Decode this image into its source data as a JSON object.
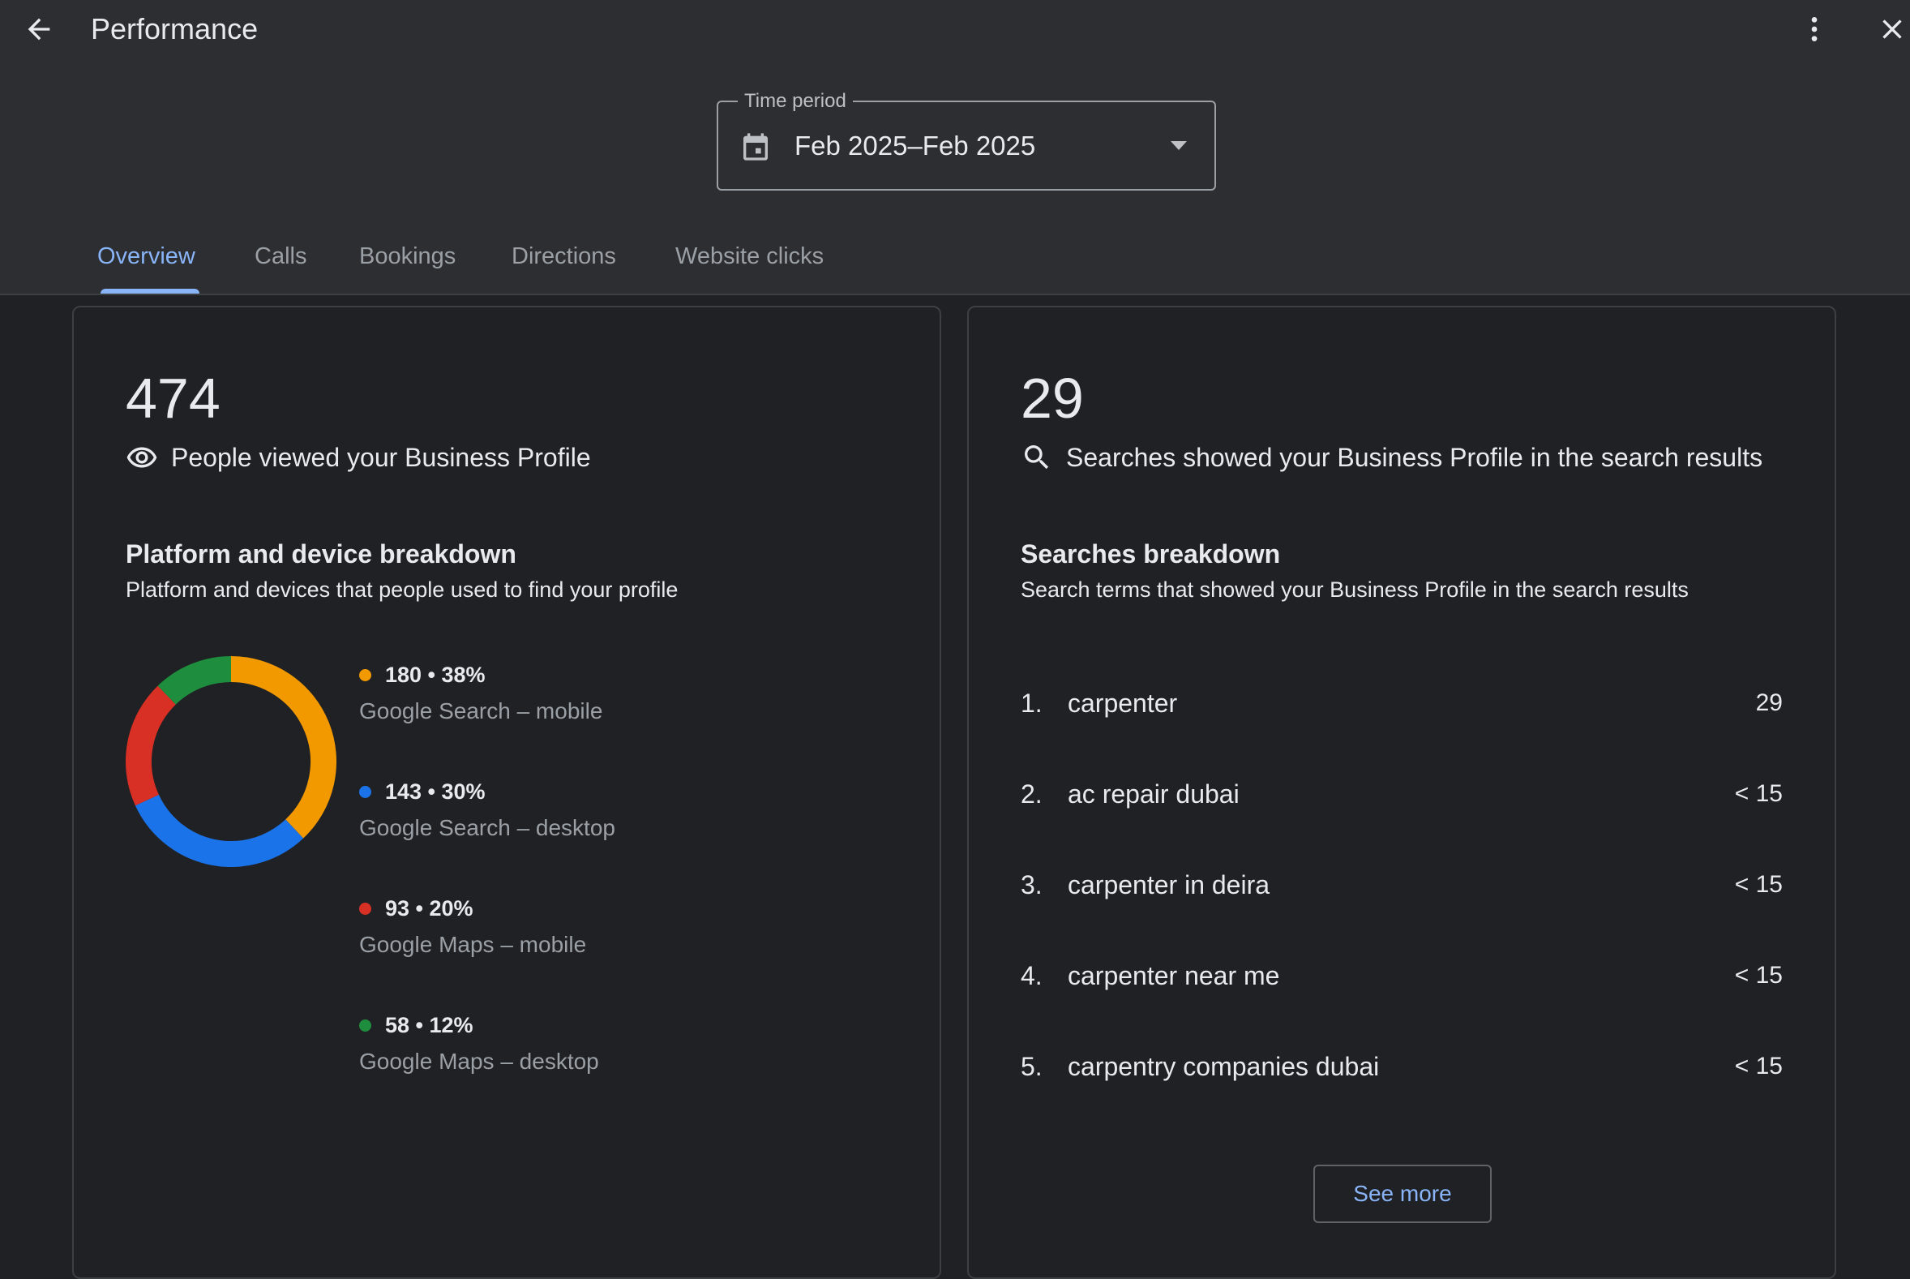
{
  "header": {
    "title": "Performance",
    "back_icon": "arrow-back-icon",
    "more_icon": "more-vert-icon",
    "close_icon": "close-icon"
  },
  "time_period": {
    "legend": "Time period",
    "value": "Feb 2025–Feb 2025",
    "icon": "calendar-icon"
  },
  "tabs": [
    {
      "label": "Overview",
      "active": true
    },
    {
      "label": "Calls",
      "active": false
    },
    {
      "label": "Bookings",
      "active": false
    },
    {
      "label": "Directions",
      "active": false
    },
    {
      "label": "Website clicks",
      "active": false
    }
  ],
  "views_card": {
    "total": "474",
    "icon": "eye-icon",
    "label": "People viewed your Business Profile",
    "breakdown_title": "Platform and device breakdown",
    "breakdown_subtitle": "Platform and devices that people used to find your profile"
  },
  "chart_data": {
    "type": "pie",
    "categories": [
      "Google Search – mobile",
      "Google Search – desktop",
      "Google Maps – mobile",
      "Google Maps – desktop"
    ],
    "values": [
      180,
      143,
      93,
      58
    ],
    "percentages": [
      "38%",
      "30%",
      "20%",
      "12%"
    ],
    "value_labels": [
      "180 • 38%",
      "143 • 30%",
      "93 • 20%",
      "58 • 12%"
    ],
    "colors": [
      "#f29900",
      "#1a73e8",
      "#d93025",
      "#1e8e3e"
    ]
  },
  "searches_card": {
    "total": "29",
    "icon": "search-icon",
    "label": "Searches showed your Business Profile in the search results",
    "breakdown_title": "Searches breakdown",
    "breakdown_subtitle": "Search terms that showed your Business Profile in the search results",
    "items": [
      {
        "rank": "1.",
        "term": "carpenter",
        "count": "29"
      },
      {
        "rank": "2.",
        "term": "ac repair dubai",
        "count": "< 15"
      },
      {
        "rank": "3.",
        "term": "carpenter in deira",
        "count": "< 15"
      },
      {
        "rank": "4.",
        "term": "carpenter near me",
        "count": "< 15"
      },
      {
        "rank": "5.",
        "term": "carpentry companies dubai",
        "count": "< 15"
      }
    ],
    "see_more_label": "See more"
  }
}
